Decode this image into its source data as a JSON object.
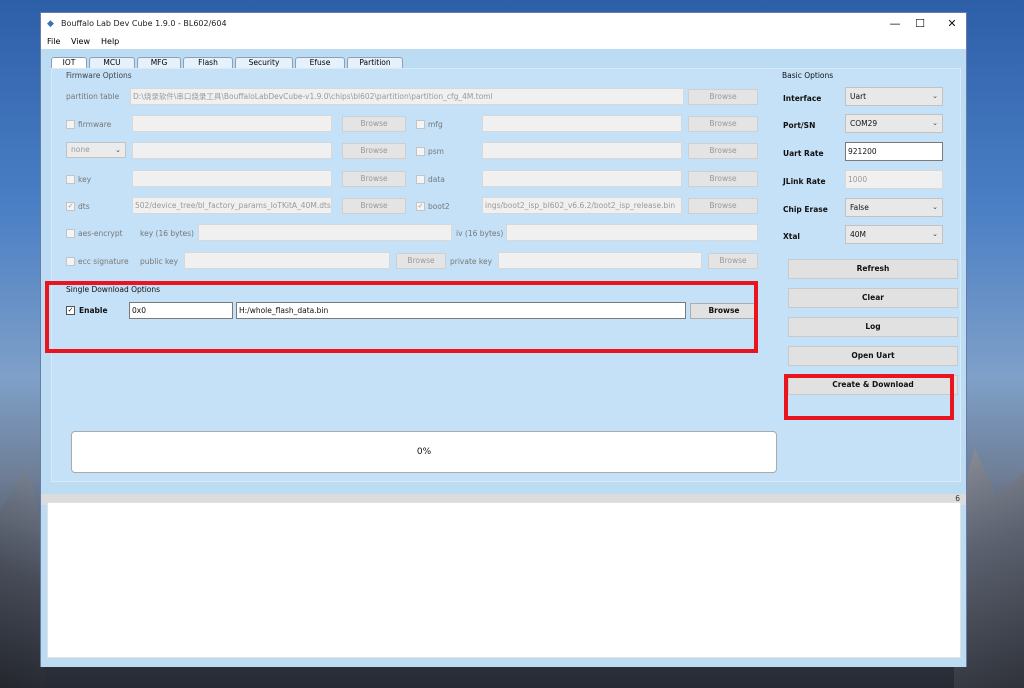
{
  "window": {
    "title": "Bouffalo Lab Dev Cube 1.9.0 - BL602/604",
    "minimize": "—",
    "maximize": "☐",
    "close": "✕"
  },
  "menu": [
    "File",
    "View",
    "Help"
  ],
  "tabs": [
    "IOT",
    "MCU",
    "MFG",
    "Flash",
    "Security",
    "Efuse",
    "Partition"
  ],
  "firmware_options": {
    "group_label": "Firmware Options",
    "partition_table": {
      "label": "partition table",
      "value": "D:\\烧录软件\\串口烧录工具\\BouffaloLabDevCube-v1.9.0\\chips\\bl602\\partition\\partition_cfg_4M.toml",
      "browse": "Browse"
    },
    "firmware": {
      "label": "firmware",
      "value": "",
      "browse": "Browse"
    },
    "mfg": {
      "label": "mfg",
      "value": "",
      "browse": "Browse"
    },
    "none_select": "none",
    "none_value": "",
    "none_browse": "Browse",
    "psm": {
      "label": "psm",
      "value": "",
      "browse": "Browse"
    },
    "key": {
      "label": "key",
      "value": "",
      "browse": "Browse"
    },
    "data": {
      "label": "data",
      "value": "",
      "browse": "Browse"
    },
    "dts": {
      "label": "dts",
      "checked": "✓",
      "value": "502/device_tree/bl_factory_params_IoTKitA_40M.dts",
      "browse": "Browse"
    },
    "boot2": {
      "label": "boot2",
      "checked": "✓",
      "value": "ings/boot2_isp_bl602_v6.6.2/boot2_isp_release.bin",
      "browse": "Browse"
    },
    "aes_encrypt": {
      "label": "aes-encrypt",
      "key_label": "key (16 bytes)",
      "iv_label": "iv (16 bytes)"
    },
    "ecc_signature": {
      "label": "ecc signature",
      "public_key_label": "public key",
      "browse": "Browse",
      "private_key_label": "private key",
      "browse2": "Browse"
    }
  },
  "single_download": {
    "group_label": "Single Download Options",
    "enable_label": "Enable",
    "enable_checked": "✓",
    "address": "0x0",
    "file": "H:/whole_flash_data.bin",
    "browse": "Browse"
  },
  "basic_options": {
    "group_label": "Basic Options",
    "interface_label": "Interface",
    "interface_value": "Uart",
    "port_label": "Port/SN",
    "port_value": "COM29",
    "uart_rate_label": "Uart Rate",
    "uart_rate_value": "921200",
    "jlink_rate_label": "JLink Rate",
    "jlink_rate_value": "1000",
    "chip_erase_label": "Chip Erase",
    "chip_erase_value": "False",
    "xtal_label": "Xtal",
    "xtal_value": "40M"
  },
  "actions": {
    "refresh": "Refresh",
    "clear": "Clear",
    "log": "Log",
    "open_uart": "Open Uart",
    "create_download": "Create & Download"
  },
  "progress": {
    "text": "0%",
    "percent": 0
  },
  "splitter_label": "6",
  "colors": {
    "highlight": "#e8141e",
    "panel": "#c4e1f7"
  }
}
